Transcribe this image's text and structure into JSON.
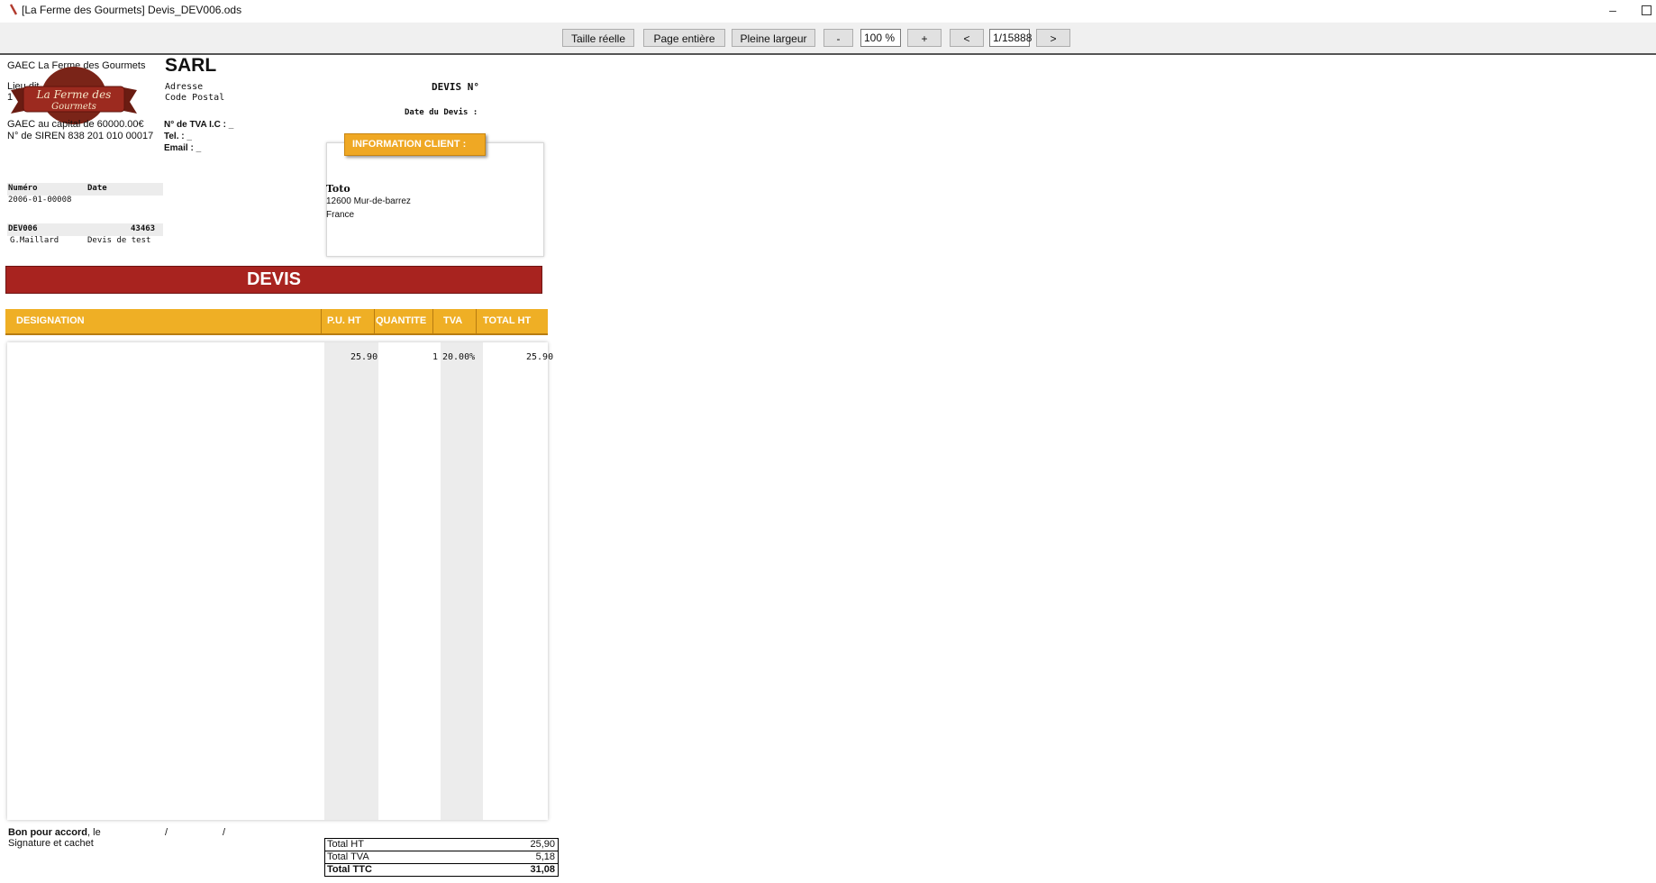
{
  "window": {
    "title": "[La Ferme des Gourmets] Devis_DEV006.ods",
    "minimize": "–"
  },
  "toolbar": {
    "actual_size": "Taille réelle",
    "full_page": "Page entière",
    "full_width": "Pleine largeur",
    "zoom_out": "-",
    "zoom_value": "100 %",
    "zoom_in": "+",
    "prev_page": "<",
    "page_value": "1/15888",
    "next_page": ">"
  },
  "company": {
    "name": "GAEC La Ferme des Gourmets",
    "address_line": "Lieu dit",
    "postal_prefix": "1",
    "capital": "GAEC  au capital de 60000.00€",
    "siren": "N° de SIREN 838 201 010 00017",
    "logo_line1": "La Ferme des",
    "logo_line2": "Gourmets"
  },
  "header_block": {
    "legal_form": "SARL",
    "address": "Adresse",
    "postal_code": "Code Postal",
    "vat_label": "N° de TVA I.C : _",
    "tel_label": "Tel. : _",
    "email_label": "Email : _"
  },
  "quote": {
    "number_label": "DEVIS N°",
    "date_label": "Date du Devis :"
  },
  "client": {
    "section_label": "INFORMATION CLIENT :",
    "name": "Toto",
    "address": "12600 Mur-de-barrez",
    "country": "France"
  },
  "meta": {
    "col_number": "Numéro",
    "col_date": "Date",
    "number_value": "2006-01-00008",
    "ref": "DEV006",
    "ref_value": "43463",
    "author": "G.Maillard",
    "description": "Devis de test"
  },
  "banner": "DEVIS",
  "table": {
    "headers": [
      "DESIGNATION",
      "P.U. HT",
      "QUANTITE",
      "TVA",
      "TOTAL HT"
    ],
    "rows": [
      {
        "designation": "",
        "unit_price": "25.90",
        "quantity": "1",
        "vat": "20.00%",
        "total": "25.90"
      }
    ]
  },
  "footer": {
    "agreement_bold": "Bon pour accord",
    "agreement_rest": ", le",
    "slash1": "/",
    "slash2": "/",
    "signature": "Signature et cachet"
  },
  "totals": [
    {
      "label": "Total HT",
      "value": "25,90"
    },
    {
      "label": "Total TVA",
      "value": "5,18"
    },
    {
      "label": "Total TTC",
      "value": "31,08"
    }
  ],
  "colors": {
    "banner_red": "#a8231f",
    "header_orange": "#efaf25",
    "gray_column": "#ececec"
  }
}
